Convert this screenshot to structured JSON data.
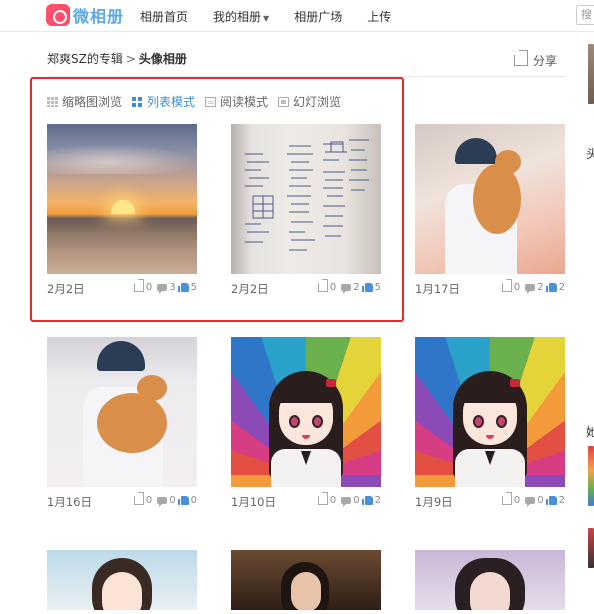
{
  "brand": {
    "name": "微相册"
  },
  "nav": {
    "items": [
      "相册首页",
      "我的相册",
      "相册广场",
      "上传"
    ],
    "search_label": "搜"
  },
  "breadcrumb": {
    "album": "郑爽SZ的专辑",
    "separator": ">",
    "current": "头像相册"
  },
  "share_label": "分享",
  "view_modes": [
    {
      "label": "缩略图浏览",
      "icon": "grid-icon",
      "active": false
    },
    {
      "label": "列表模式",
      "icon": "list-icon",
      "active": true
    },
    {
      "label": "阅读模式",
      "icon": "read-icon",
      "active": false
    },
    {
      "label": "幻灯浏览",
      "icon": "slideshow-icon",
      "active": false
    }
  ],
  "photos": [
    {
      "date": "2月2日",
      "forward": "0",
      "comments": "3",
      "likes": "5"
    },
    {
      "date": "2月2日",
      "forward": "0",
      "comments": "2",
      "likes": "5"
    },
    {
      "date": "1月17日",
      "forward": "0",
      "comments": "2",
      "likes": "2"
    },
    {
      "date": "1月16日",
      "forward": "0",
      "comments": "0",
      "likes": "0"
    },
    {
      "date": "1月10日",
      "forward": "0",
      "comments": "0",
      "likes": "2"
    },
    {
      "date": "1月9日",
      "forward": "0",
      "comments": "0",
      "likes": "2"
    }
  ],
  "side": {
    "text1": "头",
    "text2": "她"
  },
  "colors": {
    "accent": "#3c8fd6",
    "highlight": "#e82a2a",
    "brand": "#5aa9e6"
  }
}
